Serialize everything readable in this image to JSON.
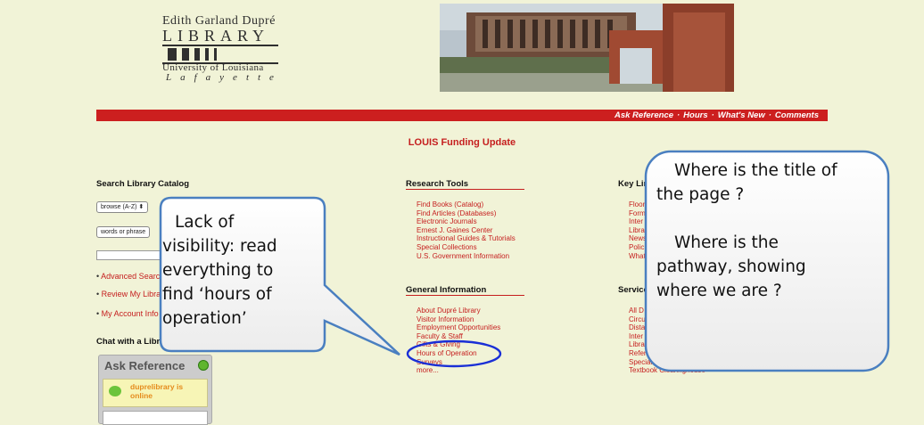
{
  "logo": {
    "line1": "Edith Garland Dupré",
    "line2": "LIBRARY",
    "line3": "University of Louisiana",
    "line4": "Lafayette"
  },
  "header_image": {
    "alt": "library-building-photo"
  },
  "topnav": {
    "items": [
      "Ask Reference",
      "Hours",
      "What's New",
      "Comments"
    ],
    "separator": "·"
  },
  "headline": "LOUIS Funding Update",
  "left": {
    "search_heading": "Search Library Catalog",
    "select1": "browse (A-Z)",
    "select2": "words or phrase",
    "links": [
      "Advanced Search",
      "Review My Library Account",
      "My Account Info"
    ],
    "chat_heading": "Chat with a Librarian",
    "ask_title": "Ask Reference",
    "online_line1": "duprelibrary is",
    "online_line2": "online"
  },
  "research_tools": {
    "heading": "Research Tools",
    "items": [
      "Find Books (Catalog)",
      "Find Articles (Databases)",
      "Electronic Journals",
      "Ernest J. Gaines Center",
      "Instructional Guides & Tutorials",
      "Special Collections",
      "U.S. Government Information"
    ]
  },
  "general_info": {
    "heading": "General Information",
    "items": [
      "About Dupré Library",
      "Visitor Information",
      "Employment Opportunities",
      "Faculty & Staff",
      "Gifts & Giving",
      "Hours of Operation",
      "Surveys",
      "more..."
    ]
  },
  "key_links": {
    "heading": "Key Links",
    "items": [
      "Floor",
      "Form",
      "Inter",
      "Libra",
      "News",
      "Polic",
      "What"
    ]
  },
  "services": {
    "heading": "Services",
    "items": [
      "All D",
      "Circu",
      "Dista",
      "Inter",
      "Libra",
      "Refer",
      "Special",
      "Textbook Clearinghouse"
    ]
  },
  "callout_left": {
    "lines": [
      "Lack of",
      "visibility: read",
      "everything to",
      "find ‘hours of",
      "operation’"
    ]
  },
  "callout_right": {
    "lines": [
      "Where is the title of",
      "the page ?",
      "",
      "Where is the",
      "pathway, showing",
      "where we are ?"
    ]
  },
  "colors": {
    "accent_red": "#cc1f1f",
    "page_bg": "#f1f3d7",
    "callout_border": "#4a7fc0",
    "highlight_oval": "#1a2fd6"
  }
}
